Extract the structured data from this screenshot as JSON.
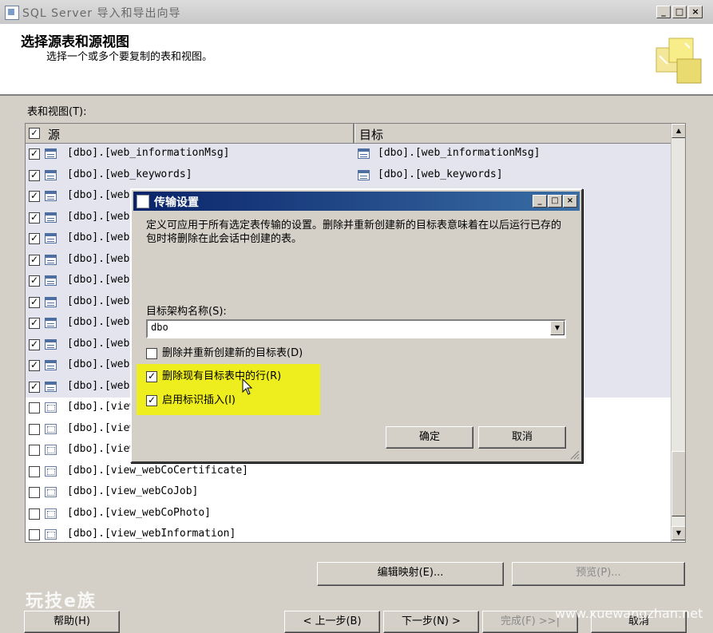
{
  "window": {
    "title": "SQL Server 导入和导出向导",
    "minimize": "_",
    "maximize": "□",
    "close": "×"
  },
  "header": {
    "title": "选择源表和源视图",
    "subtitle": "选择一个或多个要复制的表和视图。"
  },
  "tables_label": "表和视图(T):",
  "grid": {
    "col_source": "源",
    "col_target": "目标",
    "rows": [
      {
        "checked": true,
        "type": "table",
        "source": "[dbo].[web_informationMsg]",
        "target": "[dbo].[web_informationMsg]"
      },
      {
        "checked": true,
        "type": "table",
        "source": "[dbo].[web_keywords]",
        "target": "[dbo].[web_keywords]"
      },
      {
        "checked": true,
        "type": "table",
        "source": "[dbo].[web",
        "target": ""
      },
      {
        "checked": true,
        "type": "table",
        "source": "[dbo].[web",
        "target": ""
      },
      {
        "checked": true,
        "type": "table",
        "source": "[dbo].[web",
        "target": ""
      },
      {
        "checked": true,
        "type": "table",
        "source": "[dbo].[web",
        "target": ""
      },
      {
        "checked": true,
        "type": "table",
        "source": "[dbo].[web",
        "target": ""
      },
      {
        "checked": true,
        "type": "table",
        "source": "[dbo].[web",
        "target": ""
      },
      {
        "checked": true,
        "type": "table",
        "source": "[dbo].[web",
        "target": ""
      },
      {
        "checked": true,
        "type": "table",
        "source": "[dbo].[web",
        "target": ""
      },
      {
        "checked": true,
        "type": "table",
        "source": "[dbo].[web",
        "target": ""
      },
      {
        "checked": true,
        "type": "table",
        "source": "[dbo].[web",
        "target": ""
      },
      {
        "checked": false,
        "type": "view",
        "source": "[dbo].[view",
        "target": ""
      },
      {
        "checked": false,
        "type": "view",
        "source": "[dbo].[view",
        "target": ""
      },
      {
        "checked": false,
        "type": "view",
        "source": "[dbo].[view",
        "target": ""
      },
      {
        "checked": false,
        "type": "view",
        "source": "[dbo].[view_webCoCertificate]",
        "target": ""
      },
      {
        "checked": false,
        "type": "view",
        "source": "[dbo].[view_webCoJob]",
        "target": ""
      },
      {
        "checked": false,
        "type": "view",
        "source": "[dbo].[view_webCoPhoto]",
        "target": ""
      },
      {
        "checked": false,
        "type": "view",
        "source": "[dbo].[view_webInformation]",
        "target": ""
      }
    ]
  },
  "buttons": {
    "edit_mappings": "编辑映射(E)...",
    "preview": "预览(P)...",
    "help": "帮助(H)",
    "back": "< 上一步(B)",
    "next": "下一步(N) >",
    "finish": "完成(F) >>|",
    "cancel": "取消"
  },
  "dialog": {
    "title": "传输设置",
    "description": "定义可应用于所有选定表传输的设置。删除并重新创建新的目标表意味着在以后运行已存的包时将删除在此会话中创建的表。",
    "schema_label": "目标架构名称(S):",
    "schema_value": "dbo",
    "opt_drop_recreate": "删除并重新创建新的目标表(D)",
    "opt_drop_recreate_checked": false,
    "opt_delete_rows": "删除现有目标表中的行(R)",
    "opt_delete_rows_checked": true,
    "opt_identity_insert": "启用标识插入(I)",
    "opt_identity_insert_checked": true,
    "ok": "确定",
    "cancel": "取消"
  },
  "watermarks": {
    "left": "玩技e族",
    "right": "www.xuewangzhan.net"
  },
  "colors": {
    "dialog_title": "#0a246a",
    "highlight": "#f2f200",
    "face": "#d4d0c8"
  }
}
